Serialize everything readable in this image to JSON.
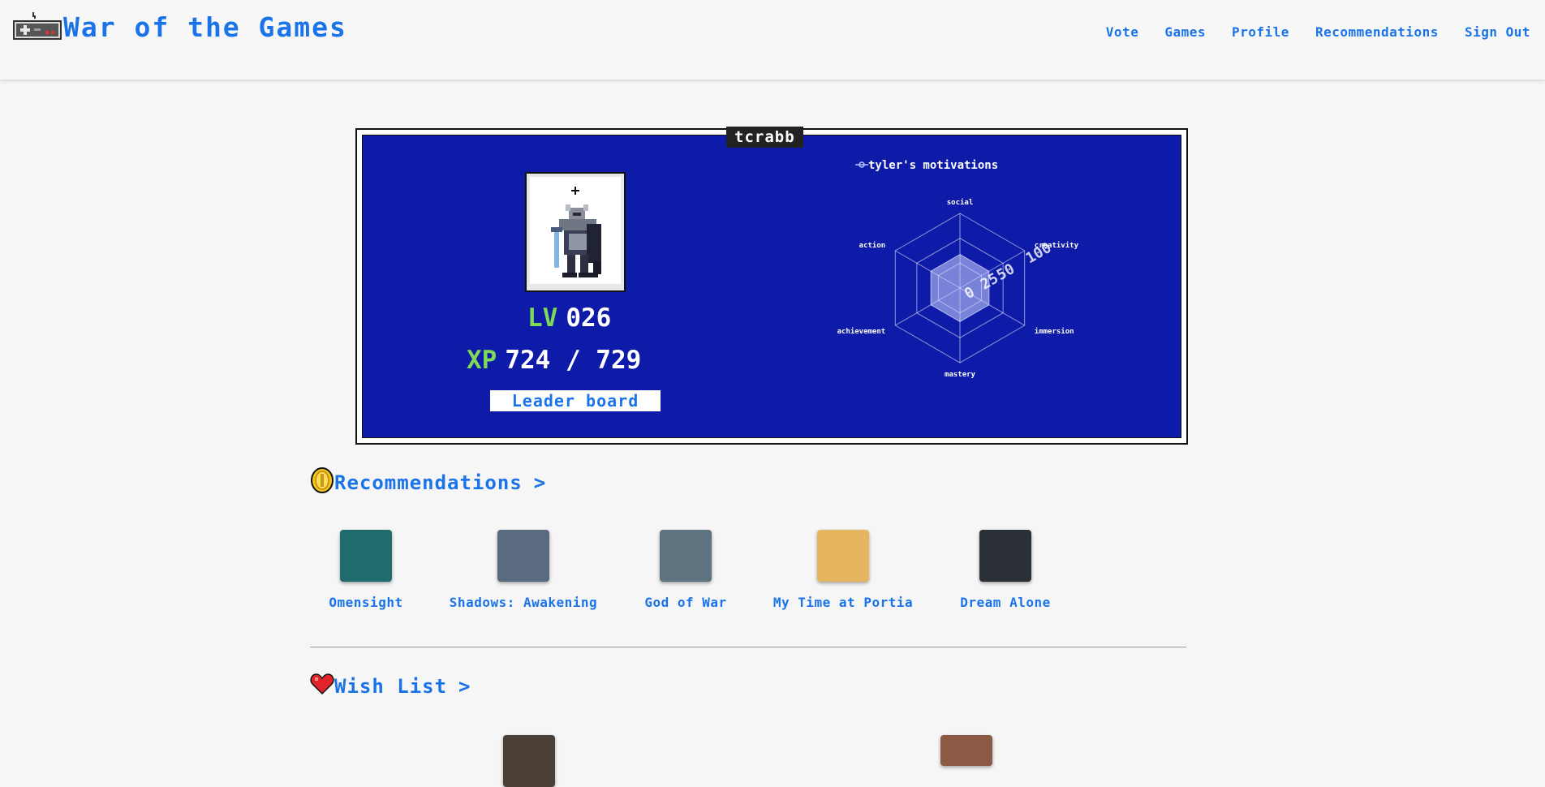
{
  "header": {
    "title": "War of the Games",
    "nav": [
      "Vote",
      "Games",
      "Profile",
      "Recommendations",
      "Sign Out"
    ]
  },
  "profile": {
    "username": "tcrabb",
    "level_label": "LV",
    "level_value": "026",
    "xp_label": "XP",
    "xp_value": "724 / 729",
    "leaderboard_label": "Leader board",
    "motivations_label": "tyler's motivations",
    "radar": {
      "axes": [
        "social",
        "creativity",
        "immersion",
        "mastery",
        "achievement",
        "action"
      ],
      "scale_labels": [
        "0",
        "25",
        "50",
        "100"
      ],
      "values": [
        45,
        45,
        45,
        45,
        45,
        45
      ]
    }
  },
  "recommendations": {
    "title": "Recommendations",
    "chevron": ">",
    "games": [
      {
        "name": "Omensight",
        "color": "#1f6b6e"
      },
      {
        "name": "Shadows: Awakening",
        "color": "#5a6a80"
      },
      {
        "name": "God of War",
        "color": "#5d7480"
      },
      {
        "name": "My Time at Portia",
        "color": "#e6b560"
      },
      {
        "name": "Dream Alone",
        "color": "#2b2f36"
      }
    ]
  },
  "wishlist": {
    "title": "Wish List",
    "chevron": ">",
    "games": [
      {
        "name": "",
        "color": "#4a4038"
      },
      {
        "name": "",
        "color": "#8a5a44"
      }
    ]
  },
  "colors": {
    "accent": "#1a73e8",
    "card_bg": "#0d1ba8",
    "stat_green": "#7ed957"
  }
}
